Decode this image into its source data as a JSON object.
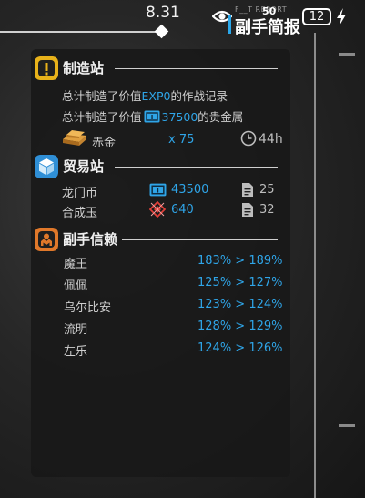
{
  "header": {
    "date": "8.31",
    "sub_report": "F__T REPORT",
    "eye_count": "50",
    "title": "副手简报",
    "battery": "12"
  },
  "manufacturing": {
    "title": "制造站",
    "line1_prefix": "总计制造了价值",
    "line1_value": "EXP0",
    "line1_suffix": "的作战记录",
    "line2_prefix": "总计制造了价值",
    "line2_value": "37500",
    "line2_suffix": "的贵金属",
    "item_name": "赤金",
    "item_count": "x 75",
    "item_time": "44h"
  },
  "trading": {
    "title": "贸易站",
    "rows": [
      {
        "label": "龙门币",
        "value": "43500",
        "orders": "25"
      },
      {
        "label": "合成玉",
        "value": "640",
        "orders": "32"
      }
    ]
  },
  "trust": {
    "title": "副手信赖",
    "rows": [
      {
        "name": "魔王",
        "change": "183% > 189%"
      },
      {
        "name": "佩佩",
        "change": "125% > 127%"
      },
      {
        "name": "乌尔比安",
        "change": "123% > 124%"
      },
      {
        "name": "流明",
        "change": "128% > 129%"
      },
      {
        "name": "左乐",
        "change": "124% > 126%"
      }
    ]
  },
  "colors": {
    "accent_blue": "#2fa5e8",
    "manufacturing_icon": "#e8b21a",
    "trading_icon": "#2f8fd6",
    "trust_icon": "#e0782a"
  }
}
